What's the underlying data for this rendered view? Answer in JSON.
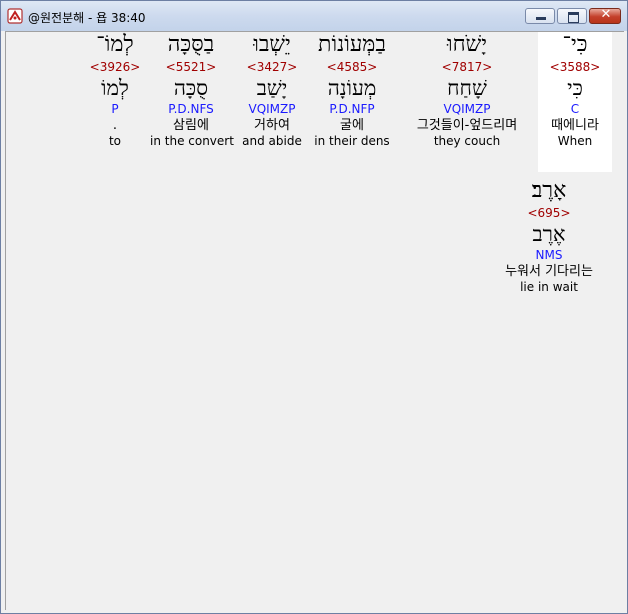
{
  "window": {
    "title": "@원전분해 - 욥 38:40"
  },
  "controls": {
    "close_label": "✕"
  },
  "words": [
    {
      "hebrew": "כִּי־",
      "strong": "<3588>",
      "lemma": "כִּי",
      "parse": "C",
      "korean": "때에니라",
      "english": "When"
    },
    {
      "hebrew": "יָשֹׁחוּ",
      "strong": "<7817>",
      "lemma": "שָׁחַח",
      "parse": "VQIMZP",
      "korean": "그것들이-엎드리며",
      "english": "they couch"
    },
    {
      "hebrew": "בַמְּעוֹנוֹת",
      "strong": "<4585>",
      "lemma": "מְעוֹנָה",
      "parse": "P.D.NFP",
      "korean": "굴에",
      "english": "in their dens"
    },
    {
      "hebrew": "יֵשְׁבוּ",
      "strong": "<3427>",
      "lemma": "יָשַׁב",
      "parse": "VQIMZP",
      "korean": "거하여",
      "english": "and abide"
    },
    {
      "hebrew": "בַסֻּכָּה",
      "strong": "<5521>",
      "lemma": "סֻכָּה",
      "parse": "P.D.NFS",
      "korean": "삼림에",
      "english": "in the convert"
    },
    {
      "hebrew": "לְמוֹ־",
      "strong": "<3926>",
      "lemma": "לְמוֹ",
      "parse": "P",
      "korean": ".",
      "english": "to"
    },
    {
      "hebrew": "אָרֶב׃",
      "strong": "<695>",
      "lemma": "אֶרֶב",
      "parse": "NMS",
      "korean": "누워서 기다리는",
      "english": "lie in wait"
    }
  ]
}
